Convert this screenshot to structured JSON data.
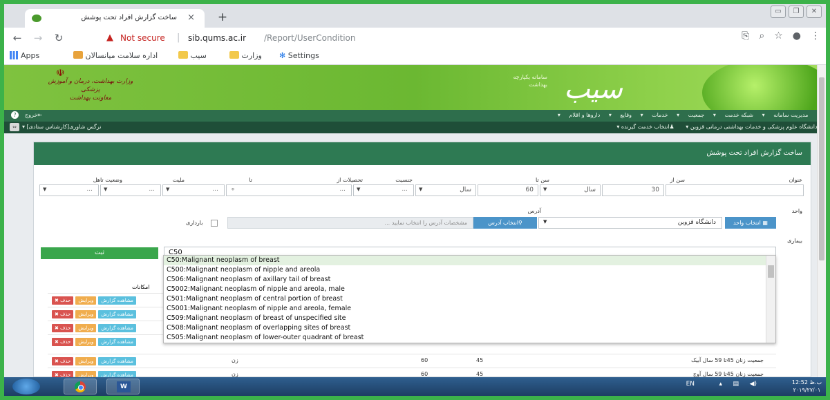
{
  "browser": {
    "tab_title": "ساخت گزارش افراد تحت پوشش",
    "tab_close": "×",
    "new_tab": "+",
    "url_status": "Not secure",
    "url_host": "sib.qums.ac.ir",
    "url_path": "/Report/UserCondition",
    "bookmarks": {
      "apps": "Apps",
      "b1": "اداره سلامت میانسالان",
      "b2": "سیب",
      "b3": "وزارت",
      "b4": "Settings"
    }
  },
  "header": {
    "ministry_line1": "وزارت بهداشت، درمان و آموزش پزشکی",
    "ministry_line2": "معاونت بهداشت",
    "logo": "سیب",
    "logo_sub": "سامانه یکپارچه بهداشت"
  },
  "menu": {
    "items": [
      "مدیریت سامانه",
      "شبکه خدمت",
      "جمعیت",
      "خدمات",
      "وقایع",
      "داروها و اقلام"
    ],
    "exit": "خروج"
  },
  "unitbar": {
    "unit": "دانشگاه علوم پزشکی و خدمات بهداشتی درمانی قزوین",
    "service_recipient": "انتخاب خدمت گیرنده",
    "user": "نرگس شاوری[کارشناس ستادی]"
  },
  "panel": {
    "title": "ساخت گزارش افراد تحت پوشش"
  },
  "filters": {
    "title_label": "عنوان",
    "age_from_label": "سن از",
    "age_from": "30",
    "age_from_unit": "سال",
    "age_to_label": "سن تا",
    "age_to": "60",
    "age_to_unit": "سال",
    "gender_label": "جنسیت",
    "gender": "...",
    "edu_from_label": "تحصیلات از",
    "edu_from": "...",
    "edu_to_label": "تا",
    "edu_to": "...",
    "nationality_label": "ملیت",
    "nationality": "...",
    "marital_label": "وضعیت تاهل",
    "marital": "...",
    "unit_label": "واحد",
    "unit_btn": "انتخاب واحد",
    "unit_value": "دانشگاه قزوین",
    "address_label": "آدرس",
    "address_btn": "انتخاب آدرس",
    "address_placeholder": "مشخصات آدرس را انتخاب نمایید ...",
    "pregnancy_label": "بارداری",
    "disease_label": "بیماری",
    "disease_value": "C50",
    "submit": "ثبت"
  },
  "autocomplete": [
    "C50:Malignant neoplasm of breast",
    "C500:Malignant neoplasm of nipple and areola",
    "C506:Malignant neoplasm of axillary tail of breast",
    "C5002:Malignant neoplasm of nipple and areola, male",
    "C501:Malignant neoplasm of central portion of breast",
    "C5001:Malignant neoplasm of nipple and areola, female",
    "C509:Malignant neoplasm of breast of unspecified site",
    "C508:Malignant neoplasm of overlapping sites of breast",
    "C505:Malignant neoplasm of lower-outer quadrant of breast"
  ],
  "table": {
    "actions_header": "امکانات",
    "btn_delete": "✖ حذف",
    "btn_edit": "ویرایش",
    "btn_view": "مشاهده گزارش",
    "rows": [
      {
        "title": "جمعیت زنان 45تا 59 سال آبیک",
        "from": "45",
        "to": "60",
        "gender": "زن"
      },
      {
        "title": "جمعیت زنان 45تا 59 سال آوج",
        "from": "45",
        "to": "60",
        "gender": "زن"
      }
    ]
  },
  "taskbar": {
    "lang": "EN",
    "time": "12:52 ب.ظ",
    "date": "۲۰۱۹/۲۷/۰۱"
  }
}
